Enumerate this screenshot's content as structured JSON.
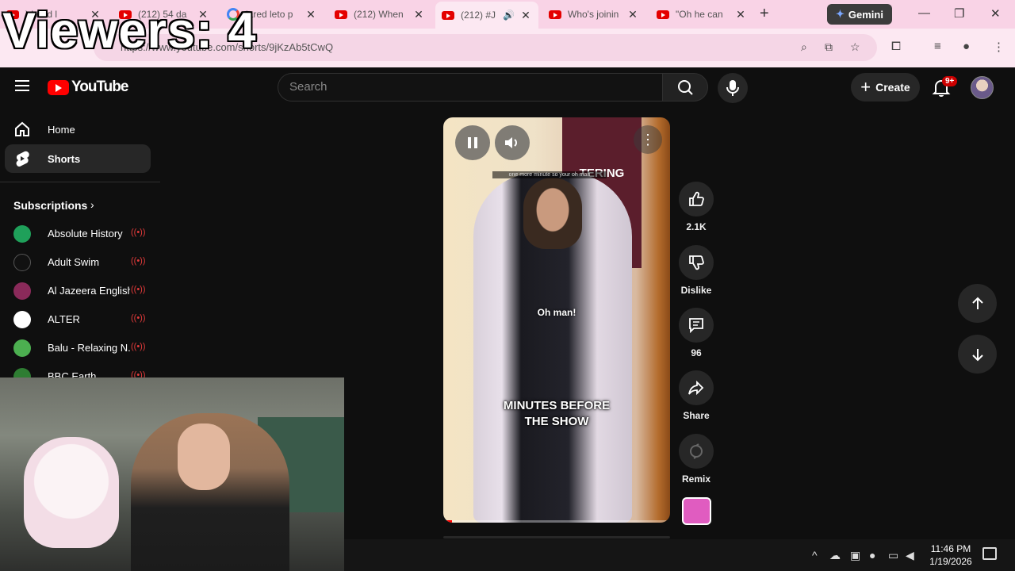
{
  "browser": {
    "tabs": [
      {
        "title": ") jared l",
        "favicon": "youtube",
        "active": false
      },
      {
        "title": "(212) 54 da",
        "favicon": "youtube",
        "active": false
      },
      {
        "title": "jared leto p",
        "favicon": "google",
        "active": false
      },
      {
        "title": "(212) When",
        "favicon": "youtube",
        "active": false
      },
      {
        "title": "(212) #J",
        "favicon": "youtube",
        "active": true,
        "playing_audio": true
      },
      {
        "title": "Who's joinin",
        "favicon": "youtube",
        "active": false
      },
      {
        "title": "\"Oh he can",
        "favicon": "youtube",
        "active": false
      }
    ],
    "new_tab_label": "+",
    "gemini_label": "Gemini",
    "url": "https://www.youtube.com/shorts/9jKzAb5tCwQ",
    "window_controls": {
      "minimize": "—",
      "restore": "❐",
      "close": "✕"
    }
  },
  "overlay": {
    "viewers_text": "Viewers: 4"
  },
  "youtube": {
    "logo_text": "YouTube",
    "search_placeholder": "Search",
    "create_label": "Create",
    "notification_badge": "9+",
    "sidebar": {
      "items": [
        {
          "label": "Home",
          "icon": "home-icon",
          "active": false
        },
        {
          "label": "Shorts",
          "icon": "shorts-icon",
          "active": true
        }
      ],
      "subscriptions_title": "Subscriptions",
      "subscriptions": [
        {
          "name": "Absolute History",
          "live": true,
          "color": "#1fa05a"
        },
        {
          "name": "Adult Swim",
          "live": true,
          "color": "#111111"
        },
        {
          "name": "Al Jazeera English",
          "live": true,
          "color": "#8a2a5a"
        },
        {
          "name": "ALTER",
          "live": true,
          "color": "#ffffff"
        },
        {
          "name": "Balu - Relaxing N...",
          "live": true,
          "color": "#4caf50"
        },
        {
          "name": "BBC Earth",
          "live": true,
          "color": "#2e7d32"
        }
      ]
    },
    "short": {
      "caption_top": "one more minute so your oh man",
      "caption_small": "Oh man!",
      "caption_main_line1": "MINUTES BEFORE",
      "caption_main_line2": "THE SHOW",
      "sign_text": "TERING",
      "progress": 0.04
    },
    "actions": {
      "like_count": "2.1K",
      "dislike_label": "Dislike",
      "comment_count": "96",
      "share_label": "Share",
      "remix_label": "Remix"
    }
  },
  "taskbar": {
    "time": "11:46 PM",
    "date": "1/19/2026"
  },
  "colors": {
    "accent": "#ff0000",
    "tabstrip": "#f9d3e6",
    "background": "#0f0f0f"
  }
}
